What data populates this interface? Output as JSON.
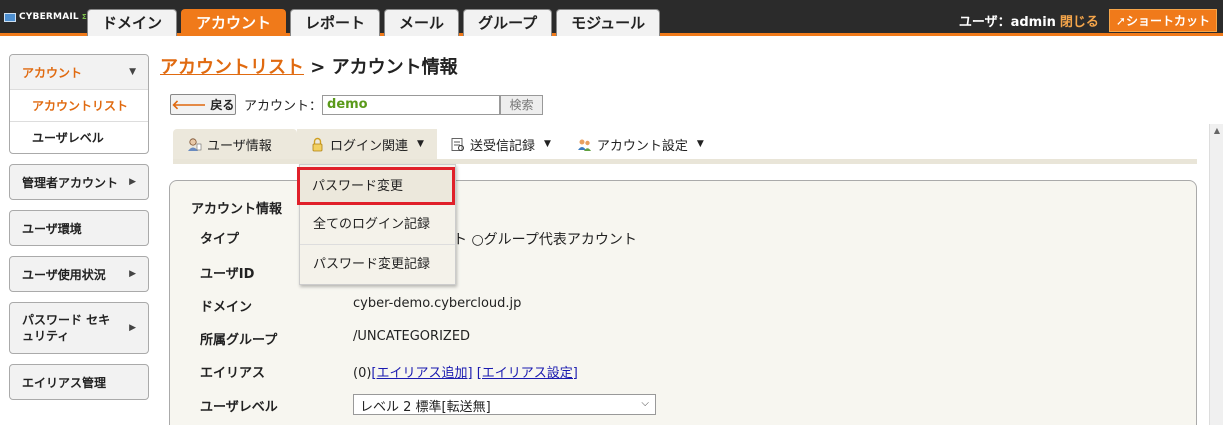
{
  "app": {
    "logo_text": "CYBERMAIL",
    "logo_sup": "Σ"
  },
  "nav": {
    "tabs": [
      {
        "label": "ドメイン",
        "active": false
      },
      {
        "label": "アカウント",
        "active": true
      },
      {
        "label": "レポート",
        "active": false
      },
      {
        "label": "メール",
        "active": false
      },
      {
        "label": "グループ",
        "active": false
      },
      {
        "label": "モジュール",
        "active": false
      }
    ]
  },
  "user": {
    "label": "ユーザ：admin",
    "close": "閉じる",
    "shortcut": "ショートカット"
  },
  "sidebar": {
    "account_group": "アカウント",
    "account_items": [
      "アカウントリスト",
      "ユーザレベル"
    ],
    "items": [
      "管理者アカウント",
      "ユーザ環境",
      "ユーザ使用状況",
      "パスワード セキュリティ",
      "エイリアス管理"
    ]
  },
  "breadcrumb": {
    "link": "アカウントリスト",
    "sep": " > ",
    "current": "アカウント情報"
  },
  "toolbar": {
    "back_label": "戻る",
    "account_label": "アカウント：",
    "account_value": "demo",
    "search_label": "検索"
  },
  "subtabs": [
    {
      "label": "ユーザ情報",
      "icon": "user-icon"
    },
    {
      "label": "ログイン関連",
      "icon": "lock-icon"
    },
    {
      "label": "送受信記録",
      "icon": "mail-log-icon"
    },
    {
      "label": "アカウント設定",
      "icon": "users-settings-icon"
    }
  ],
  "dropdown": {
    "items": [
      "パスワード変更",
      "全てのログイン記録",
      "パスワード変更記録"
    ]
  },
  "panel": {
    "title": "アカウント情報",
    "rows": [
      {
        "label": "タイプ",
        "value": "ト ○グループ代表アカウント"
      },
      {
        "label": "ユーザID",
        "value": ""
      },
      {
        "label": "ドメイン",
        "value": "cyber-demo.cybercloud.jp"
      },
      {
        "label": "所属グループ",
        "value": "/UNCATEGORIZED"
      },
      {
        "label": "エイリアス",
        "value_prefix": "(0)",
        "link1": "[エイリアス追加]",
        "link2": "[エイリアス設定]"
      },
      {
        "label": "ユーザレベル",
        "select_value": "レベル 2 標準[転送無]"
      }
    ]
  },
  "colors": {
    "accent": "#f07a1a",
    "highlight": "#e0202a",
    "topbar": "#2b2b2b"
  }
}
